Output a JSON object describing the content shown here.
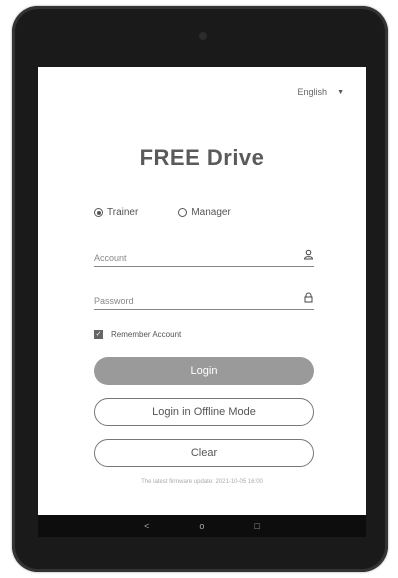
{
  "language": {
    "label": "English",
    "caret": "▼"
  },
  "app": {
    "title": "FREE Drive"
  },
  "roles": [
    {
      "label": "Trainer",
      "checked": true
    },
    {
      "label": "Manager",
      "checked": false
    }
  ],
  "form": {
    "account_placeholder": "Account",
    "password_placeholder": "Password",
    "remember_label": "Remember Account"
  },
  "buttons": {
    "login": "Login",
    "offline": "Login in Offline Mode",
    "clear": "Clear"
  },
  "footer": {
    "text": "The latest firmware update: 2021-10-05 16:00"
  },
  "navbar": {
    "back": "<",
    "home": "o",
    "recent": "□"
  }
}
